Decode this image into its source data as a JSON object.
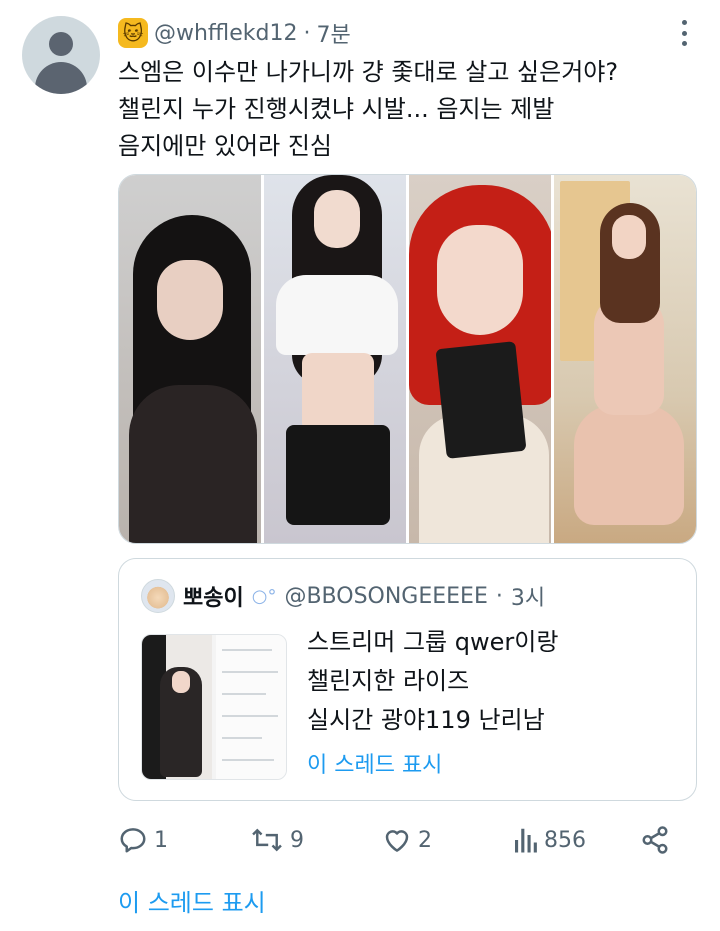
{
  "tweet": {
    "author_handle": "@whfflekd12",
    "separator": "·",
    "time": "7분",
    "text_lines": [
      "스엠은 이수만 나가니까 걍 좇대로 살고 싶은거야?",
      "챌린지 누가 진행시켰냐 시발... 음지는 제발",
      "음지에만 있어라 진심"
    ]
  },
  "quote": {
    "name": "뽀송이",
    "handle": "@BBOSONGEEEEE",
    "separator": "·",
    "time": "3시",
    "text_lines": [
      "스트리머 그룹 qwer이랑",
      "챌린지한 라이즈",
      "실시간 광야119 난리남"
    ],
    "show_thread": "이 스레드 표시"
  },
  "actions": {
    "replies": "1",
    "retweets": "9",
    "likes": "2",
    "views": "856"
  },
  "show_thread": "이 스레드 표시",
  "colors": {
    "link": "#1d9bf0",
    "secondary_text": "#536471",
    "border": "#cfd9de"
  }
}
